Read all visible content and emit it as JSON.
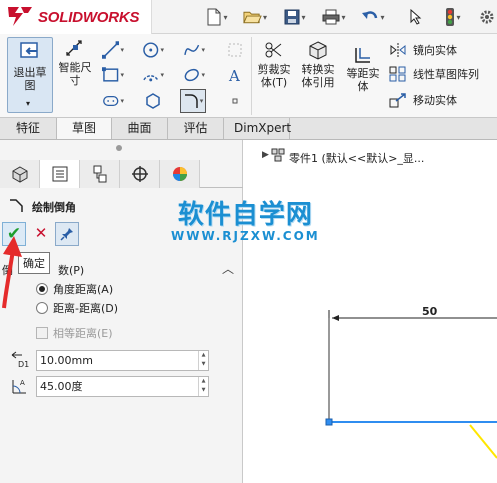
{
  "app": {
    "logo_text": "SOLIDWORKS",
    "brand_color": "#c8102e"
  },
  "quick_access": [
    {
      "icon": "new-document-icon",
      "glyph": "☐"
    },
    {
      "icon": "open-folder-icon",
      "glyph": "❐"
    },
    {
      "icon": "save-icon",
      "glyph": "▣"
    },
    {
      "icon": "print-icon",
      "glyph": "⎙"
    },
    {
      "icon": "undo-icon",
      "glyph": "↶"
    },
    {
      "icon": "select-arrow-icon",
      "glyph": "↖"
    },
    {
      "icon": "traffic-light-icon",
      "glyph": "●"
    }
  ],
  "ribbon": {
    "exit_sketch_label": "退出草\n图",
    "smart_dim_label": "智能尺\n寸",
    "trim_label": "剪裁实\n体(T)",
    "convert_label": "转换实\n体引用",
    "offset_label": "等距实\n体",
    "mirror_label": "镜向实体",
    "linear_pattern_label": "线性草图阵列",
    "move_label": "移动实体"
  },
  "tabs": [
    "特征",
    "草图",
    "曲面",
    "评估",
    "DimXpert"
  ],
  "active_tab": 1,
  "property_manager": {
    "title": "绘制倒角",
    "ok_tooltip": "确定",
    "section_label": "数(P)",
    "section_prefix": "倒",
    "options": [
      {
        "label": "角度距离(A)",
        "checked": true
      },
      {
        "label": "距离-距离(D)",
        "checked": false
      }
    ],
    "equal_distance_label": "相等距离(E)",
    "distance_value": "10.00mm",
    "distance_icon_label": "D1",
    "angle_value": "45.00度"
  },
  "tree": {
    "label": "零件1  (默认<<默认>_显..."
  },
  "watermark": {
    "title": "软件自学网",
    "url": "WWW.RJZXW.COM"
  },
  "sketch": {
    "dimension_value": "50"
  }
}
